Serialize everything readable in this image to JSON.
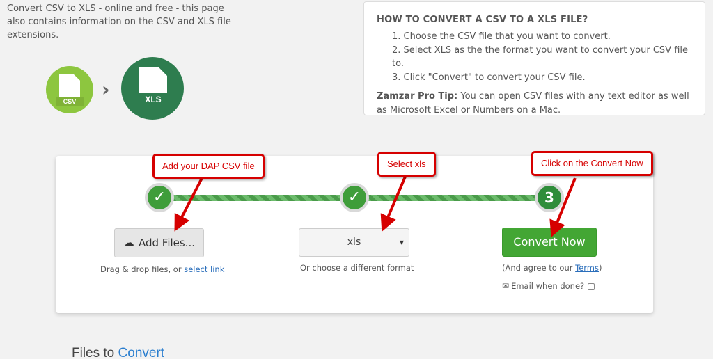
{
  "intro_text": "Convert CSV to XLS - online and free - this page also contains information on the CSV and XLS file extensions.",
  "icons": {
    "source_label": "CSV",
    "target_label": "XLS",
    "separator": "›"
  },
  "howto": {
    "title": "HOW TO CONVERT A CSV TO A XLS FILE?",
    "steps": [
      "1. Choose the CSV file that you want to convert.",
      "2. Select XLS as the the format you want to convert your CSV file to.",
      "3. Click \"Convert\" to convert your CSV file."
    ],
    "tip_label": "Zamzar Pro Tip:",
    "tip_text": " You can open CSV files with any text editor as well as Microsoft Excel or Numbers on a Mac."
  },
  "converter": {
    "step1_mark": "✓",
    "step2_mark": "✓",
    "step3_mark": "3",
    "add_files_label": "Add Files...",
    "drag_text": "Drag & drop files, or ",
    "select_link": "select link",
    "format_value": "xls",
    "choose_text": "Or choose a different format",
    "convert_label": "Convert Now",
    "agree_prefix": "(And agree to our ",
    "terms_link": "Terms",
    "agree_suffix": ")",
    "email_label": "Email when done?"
  },
  "callouts": {
    "add": "Add your DAP CSV file",
    "select": "Select xls",
    "convert": "Click on the Convert Now"
  },
  "files_title": {
    "prefix": "Files to ",
    "highlight": "Convert"
  },
  "colors": {
    "accent_green": "#43a634",
    "callout_red": "#d60000",
    "link_blue": "#2a6ebb"
  }
}
